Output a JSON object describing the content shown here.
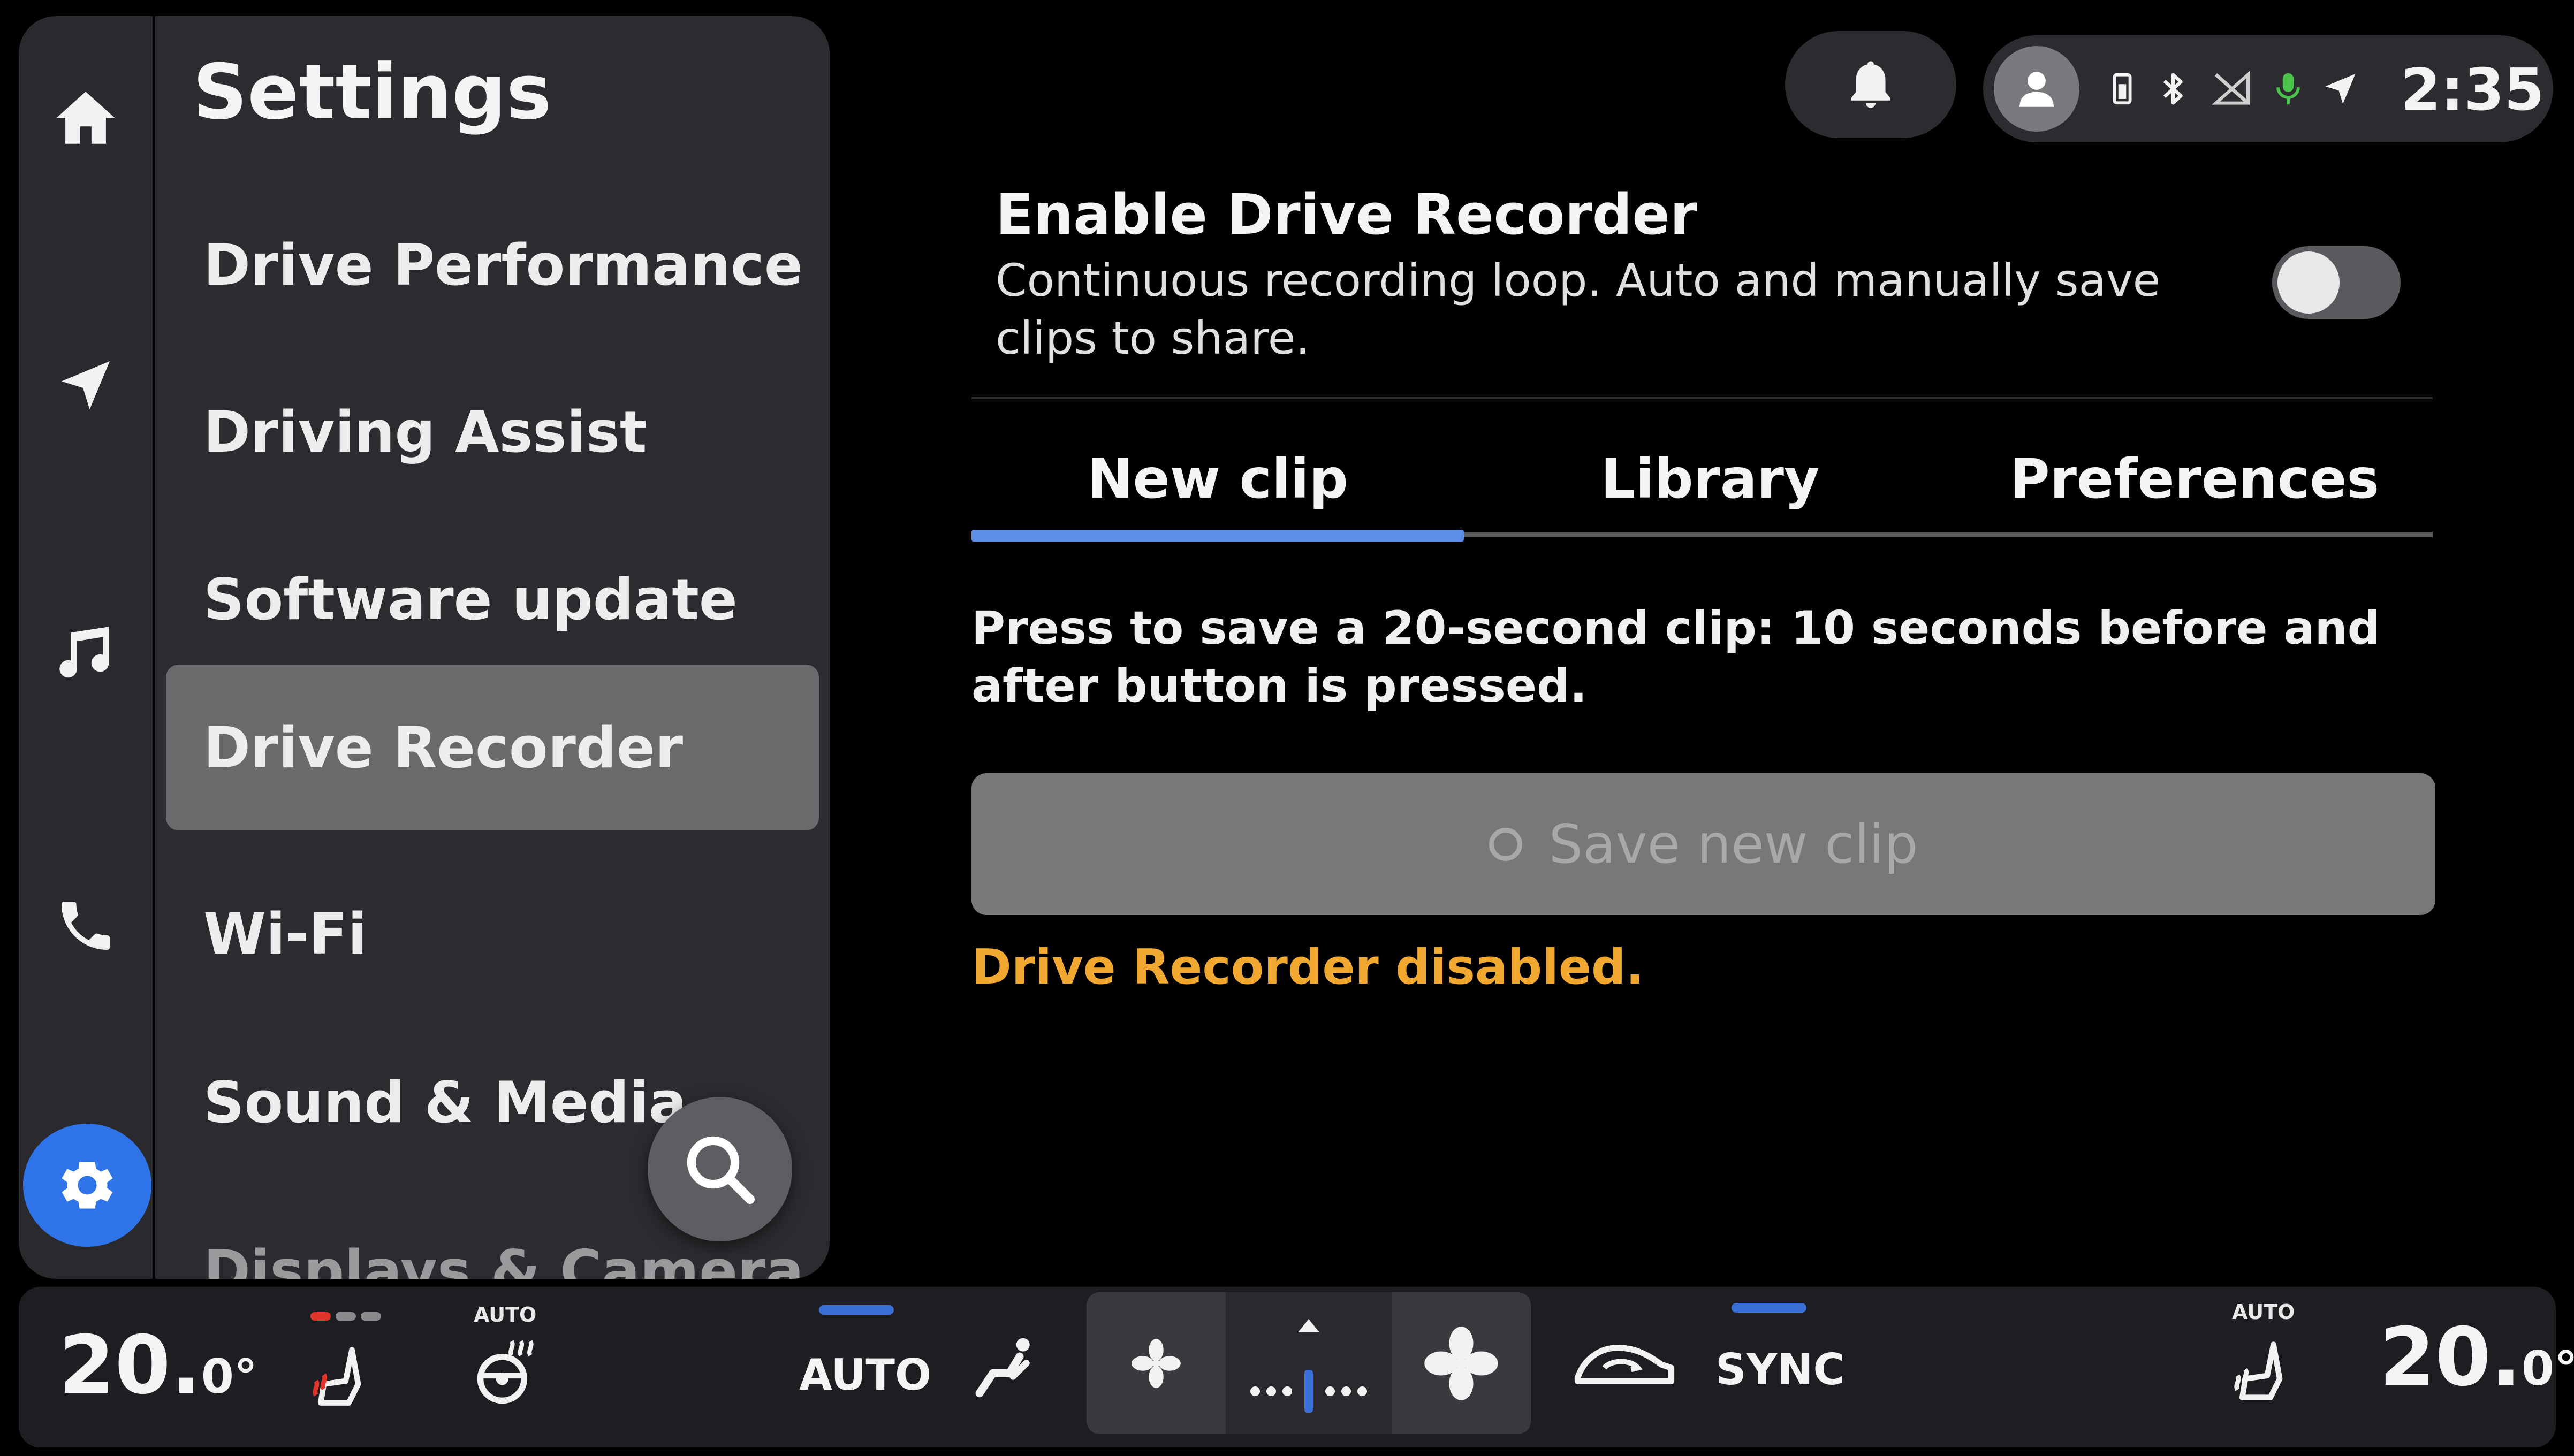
{
  "rail": {
    "items": [
      {
        "name": "home",
        "icon": "home-icon"
      },
      {
        "name": "navigation",
        "icon": "navigation-arrow-icon"
      },
      {
        "name": "music",
        "icon": "music-note-icon"
      },
      {
        "name": "phone",
        "icon": "phone-icon"
      },
      {
        "name": "settings",
        "icon": "gear-icon",
        "active": true
      }
    ],
    "active_color": "#2f73e8"
  },
  "settings": {
    "title": "Settings",
    "items": [
      {
        "label": "Drive Performance"
      },
      {
        "label": "Driving Assist"
      },
      {
        "label": "Software update"
      },
      {
        "label": "Drive Recorder",
        "selected": true
      },
      {
        "label": "Wi-Fi"
      },
      {
        "label": "Sound & Media"
      },
      {
        "label": "Displays & Camera"
      }
    ]
  },
  "status_bar": {
    "icons": [
      "bell-icon",
      "user-avatar-icon",
      "phone-battery-icon",
      "bluetooth-icon",
      "no-signal-icon",
      "microphone-icon",
      "location-arrow-icon"
    ],
    "mic_color": "#4cc34c",
    "time": "2:35"
  },
  "drive_recorder": {
    "enable_title": "Enable Drive Recorder",
    "enable_description": "Continuous recording loop. Auto and manually save clips to share.",
    "enabled": false,
    "tabs": [
      {
        "label": "New clip",
        "active": true
      },
      {
        "label": "Library"
      },
      {
        "label": "Preferences"
      }
    ],
    "tab_indicator_color": "#5d8ee8",
    "instruction": "Press to save a 20-second clip: 10 seconds before and after button is pressed.",
    "save_button_label": "Save new clip",
    "status_message": "Drive Recorder disabled.",
    "status_color": "#f0a830"
  },
  "climate": {
    "left_temp": "20.",
    "left_temp_unit": "0°",
    "right_temp": "20.",
    "right_temp_unit": "0°",
    "auto_label": "AUTO",
    "seat_auto_label": "AUTO",
    "steering_auto_label": "AUTO",
    "sync_label": "SYNC",
    "icons": [
      "seat-heat-icon",
      "steering-heat-icon",
      "airflow-icon",
      "fan-low-icon",
      "fan-speed-slider-icon",
      "fan-high-icon",
      "recirculation-icon",
      "seat-heat-right-icon"
    ]
  }
}
